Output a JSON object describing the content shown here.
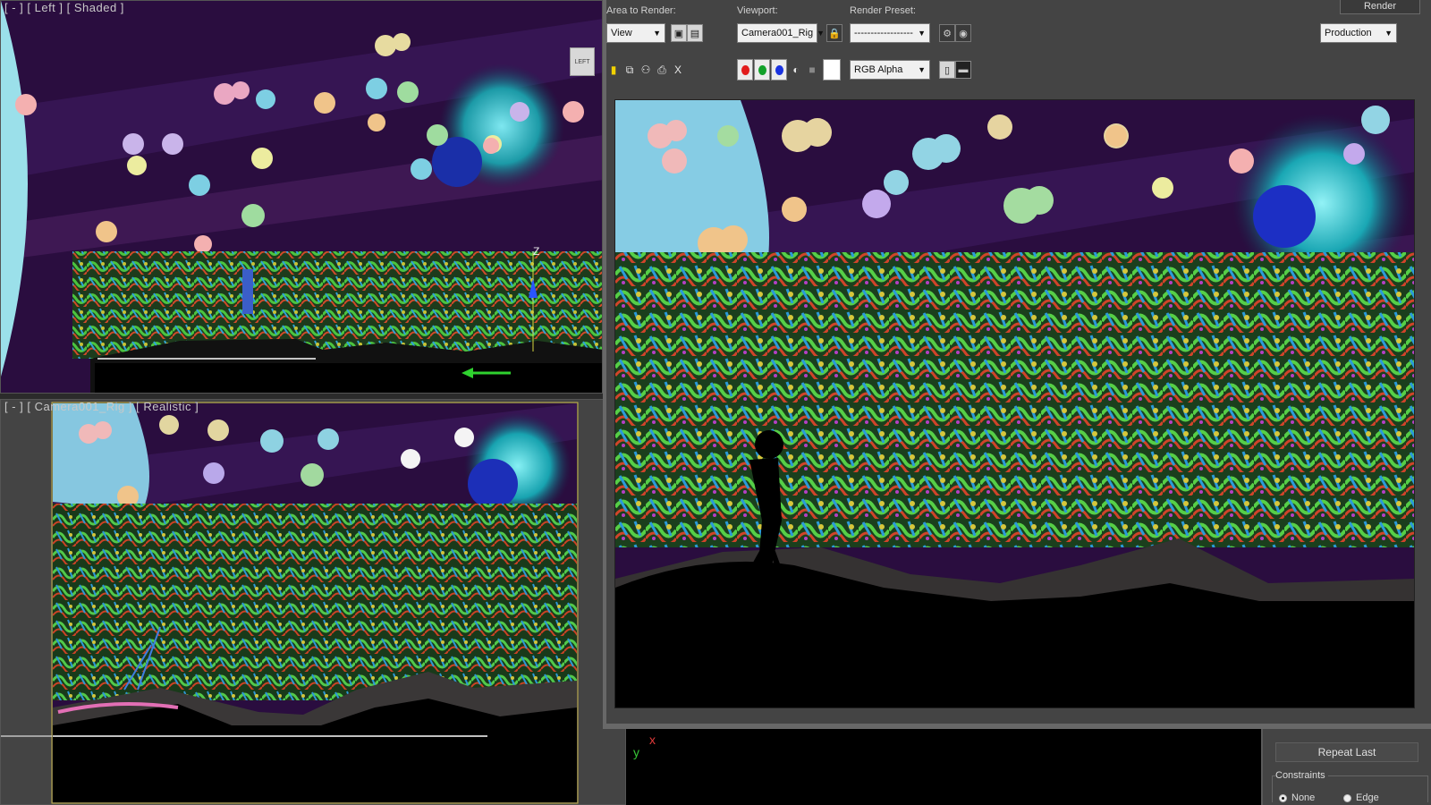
{
  "viewports": {
    "left": {
      "label": "[ - ] [ Left ] [ Shaded ]",
      "viewcube_face": "LEFT",
      "gizmo_label": "Z"
    },
    "camera": {
      "label": "[ - ] [ Camera001_Rig ] [ Realistic ]"
    }
  },
  "render_window": {
    "area_label": "Area to Render:",
    "area_value": "View",
    "viewport_label": "Viewport:",
    "viewport_value": "Camera001_Rig",
    "preset_label": "Render Preset:",
    "preset_value": "------------------",
    "render_button": "Render",
    "production_value": "Production",
    "channel_value": "RGB Alpha",
    "close_glyph": "X"
  },
  "command_panel": {
    "repeat_label": "Repeat Last",
    "constraints_label": "Constraints",
    "radio_none": "None",
    "radio_edge": "Edge"
  },
  "axes": {
    "y": "y",
    "x": "x"
  },
  "colors": {
    "sky": "#2a0d3f",
    "foliage_green": "#3fa83a",
    "ground": "#000000",
    "hill": "#383535",
    "moon": "#29bfc8"
  }
}
